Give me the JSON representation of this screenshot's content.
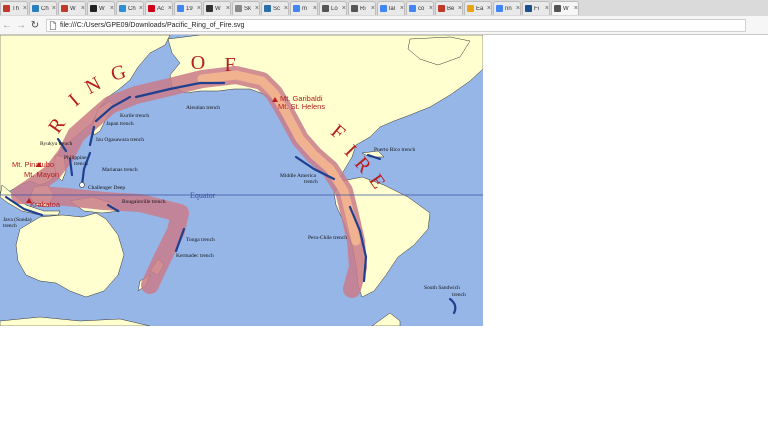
{
  "browser": {
    "tabs": [
      {
        "title": "Th",
        "favicon_color": "#c0392b",
        "close": "×"
      },
      {
        "title": "Ch",
        "favicon_color": "#2a7fbf",
        "close": "×"
      },
      {
        "title": "W",
        "favicon_color": "#c0392b",
        "close": "×"
      },
      {
        "title": "W",
        "favicon_color": "#222222",
        "close": "×"
      },
      {
        "title": "Ch",
        "favicon_color": "#2f8fd6",
        "close": "×"
      },
      {
        "title": "Ac",
        "favicon_color": "#d0021b",
        "close": "×"
      },
      {
        "title": "19",
        "favicon_color": "#4285f4",
        "close": "×"
      },
      {
        "title": "W",
        "favicon_color": "#333333",
        "close": "×"
      },
      {
        "title": "Sk",
        "favicon_color": "#888888",
        "close": "×"
      },
      {
        "title": "Sc",
        "favicon_color": "#2a6fa8",
        "close": "×"
      },
      {
        "title": "m",
        "favicon_color": "#4285f4",
        "close": "×"
      },
      {
        "title": "Lo",
        "favicon_color": "#555555",
        "close": "×"
      },
      {
        "title": "Ri",
        "favicon_color": "#555555",
        "close": "×"
      },
      {
        "title": "lal",
        "favicon_color": "#4285f4",
        "close": "×"
      },
      {
        "title": "co",
        "favicon_color": "#4285f4",
        "close": "×"
      },
      {
        "title": "Be",
        "favicon_color": "#c0392b",
        "close": "×"
      },
      {
        "title": "Ea",
        "favicon_color": "#e8a317",
        "close": "×"
      },
      {
        "title": "rin",
        "favicon_color": "#4285f4",
        "close": "×"
      },
      {
        "title": "Fi",
        "favicon_color": "#1a4f8b",
        "close": "×"
      },
      {
        "title": "W",
        "favicon_color": "#555555",
        "close": "×"
      }
    ],
    "active_tab_index": 19,
    "back_icon": "←",
    "forward_icon": "→",
    "reload_icon": "↻",
    "url": "file:///C:/Users/GPE09/Downloads/Pacific_Ring_of_Fire.svg"
  },
  "map": {
    "colors": {
      "ocean": "#97b6e8",
      "land": "#ffffd0",
      "band_outer": "#c97b8a",
      "band_inner": "#f2b48f",
      "trench": "#1f3f8f",
      "title": "#b81c1c",
      "volcano_label": "#b81c1c",
      "equator": "#3a52a0"
    },
    "title_letters": {
      "r": "R",
      "i1": "I",
      "n": "N",
      "g": "G",
      "o": "O",
      "f1": "F",
      "f2": "F",
      "i2": "I",
      "r2": "R",
      "e": "E"
    },
    "equator_label": "Equator",
    "trenches": {
      "kurile": "Kurile trench",
      "japan": "Japan trench",
      "aleutian": "Aleutian trench",
      "izu": "Izu Ogasawara trench",
      "ryukyu": "Ryukyu trench",
      "philippine1": "Philippine",
      "philippine2": "trench",
      "marianas": "Marianas trench",
      "challenger": "Challenger Deep",
      "bougainville": "Bougainville trench",
      "java1": "Java (Sunda)",
      "java2": "trench",
      "tonga": "Tonga trench",
      "kermadec": "Kermadec trench",
      "middle1": "Middle America",
      "middle2": "trench",
      "puerto": "Puerto Rico trench",
      "peru": "Peru-Chile trench",
      "south1": "South Sandwich",
      "south2": "trench"
    },
    "volcanoes": {
      "garibaldi": "Mt. Garibaldi",
      "helens": "Mt. St. Helens",
      "pinatubo": "Mt. Pinatubo",
      "mayon": "Mt. Mayon",
      "krakatoa": "Krakatoa"
    }
  }
}
